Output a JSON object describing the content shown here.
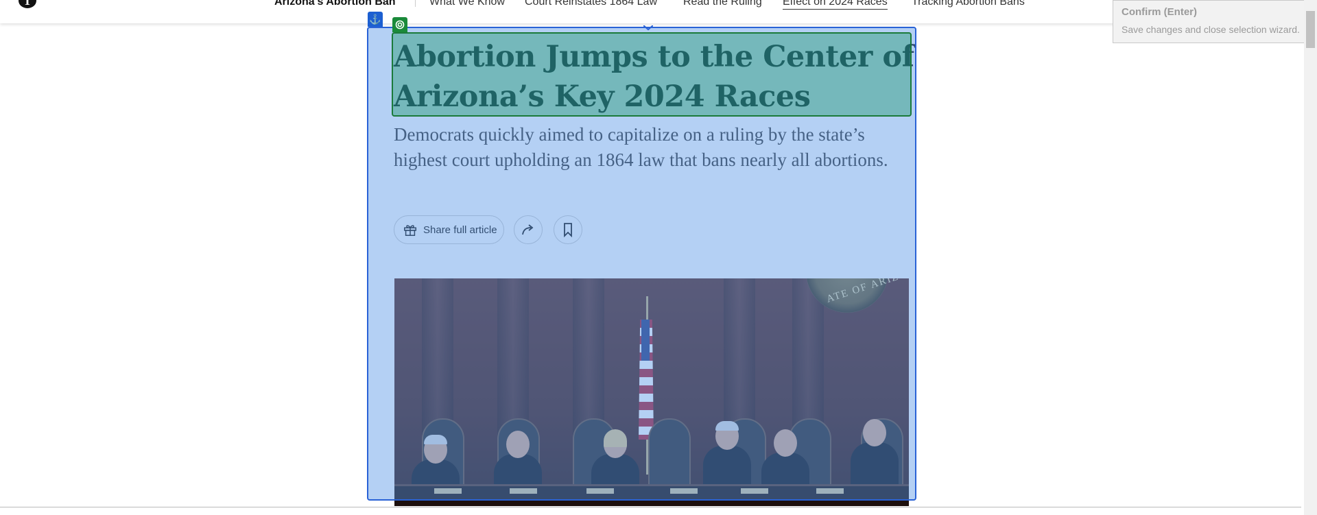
{
  "nav": {
    "logo": "T",
    "title": "Arizona's Abortion Ban",
    "links": [
      {
        "label": "What We Know"
      },
      {
        "label": "Court Reinstates 1864 Law"
      },
      {
        "label": "Read the Ruling"
      },
      {
        "label": "Effect on 2024 Races",
        "active": true
      },
      {
        "label": "Tracking Abortion Bans"
      }
    ]
  },
  "article": {
    "headline": "Abortion Jumps to the Center of Arizona’s Key 2024 Races",
    "summary": "Democrats quickly aimed to capitalize on a ruling by the state’s highest court upholding an 1864 law that bans nearly all abortions.",
    "share_label": "Share full article",
    "icons": {
      "gift": "gift-icon",
      "share": "share-arrow-icon",
      "bookmark": "bookmark-icon"
    },
    "photo": {
      "seal_text": "ATE OF ARIZ"
    }
  },
  "wizard": {
    "anchor_icon": "anchor-icon",
    "target_icon": "target-icon",
    "tooltip_title": "Confirm (Enter)",
    "tooltip_desc": "Save changes and close selection wizard."
  },
  "colors": {
    "selection_blue": "#2962d6",
    "target_green": "#1a7a3a",
    "flag_red": "#b22234"
  }
}
